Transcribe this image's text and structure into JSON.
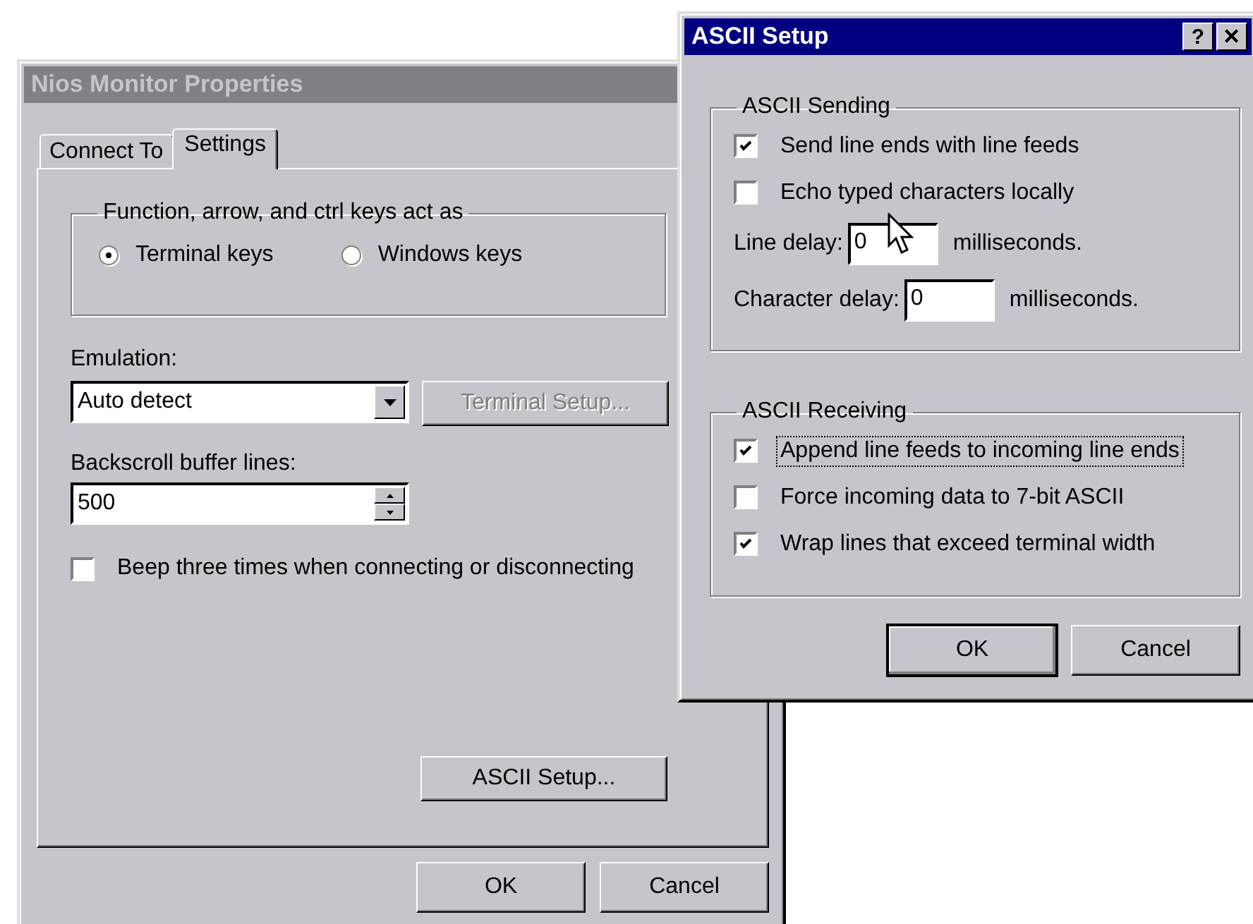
{
  "properties_window": {
    "title": "Nios Monitor Properties",
    "active": false,
    "tabs": [
      {
        "label": "Connect To",
        "selected": false
      },
      {
        "label": "Settings",
        "selected": true
      }
    ],
    "keys_group": {
      "label": "Function, arrow, and ctrl keys act as",
      "options": [
        {
          "label": "Terminal keys",
          "selected": true
        },
        {
          "label": "Windows keys",
          "selected": false
        }
      ]
    },
    "emulation": {
      "label": "Emulation:",
      "value": "Auto detect"
    },
    "terminal_setup_button": {
      "label": "Terminal Setup...",
      "disabled": true
    },
    "backscroll": {
      "label": "Backscroll buffer lines:",
      "value": "500"
    },
    "beep": {
      "label": "Beep three times when connecting or disconnecting",
      "checked": false
    },
    "ascii_setup_button": {
      "label": "ASCII Setup...",
      "disabled": false
    },
    "buttons": [
      {
        "label": "OK",
        "default": false
      },
      {
        "label": "Cancel",
        "default": false
      }
    ]
  },
  "ascii_setup_dialog": {
    "title": "ASCII Setup",
    "active": true,
    "title_buttons": [
      "?",
      "✕"
    ],
    "sending": {
      "label": "ASCII Sending",
      "checkboxes": [
        {
          "label": "Send line ends with line feeds",
          "checked": true,
          "focused": false
        },
        {
          "label": "Echo typed characters locally",
          "checked": false,
          "focused": false
        }
      ],
      "delays": [
        {
          "label": "Line delay:",
          "value": "0",
          "unit": "milliseconds."
        },
        {
          "label": "Character delay:",
          "value": "0",
          "unit": "milliseconds."
        }
      ]
    },
    "receiving": {
      "label": "ASCII Receiving",
      "checkboxes": [
        {
          "label": "Append line feeds to incoming line ends",
          "checked": true,
          "focused": true
        },
        {
          "label": "Force incoming data to 7-bit ASCII",
          "checked": false,
          "focused": false
        },
        {
          "label": "Wrap lines that exceed terminal width",
          "checked": true,
          "focused": false
        }
      ]
    },
    "buttons": [
      {
        "label": "OK",
        "default": true
      },
      {
        "label": "Cancel",
        "default": false
      }
    ]
  }
}
